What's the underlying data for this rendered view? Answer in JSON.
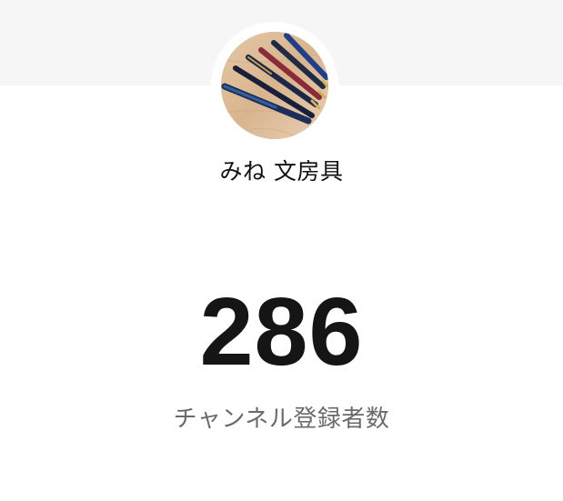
{
  "profile": {
    "channel_name": "みね 文房具",
    "avatar_icon": "avatar-photo-fountain-pens"
  },
  "stats": {
    "subscriber_count": "286",
    "subscriber_label": "チャンネル登録者数"
  },
  "colors": {
    "banner_background": "#f6f6f6",
    "page_background": "#ffffff",
    "count_text": "#151515",
    "label_text": "#6a6a6a"
  }
}
